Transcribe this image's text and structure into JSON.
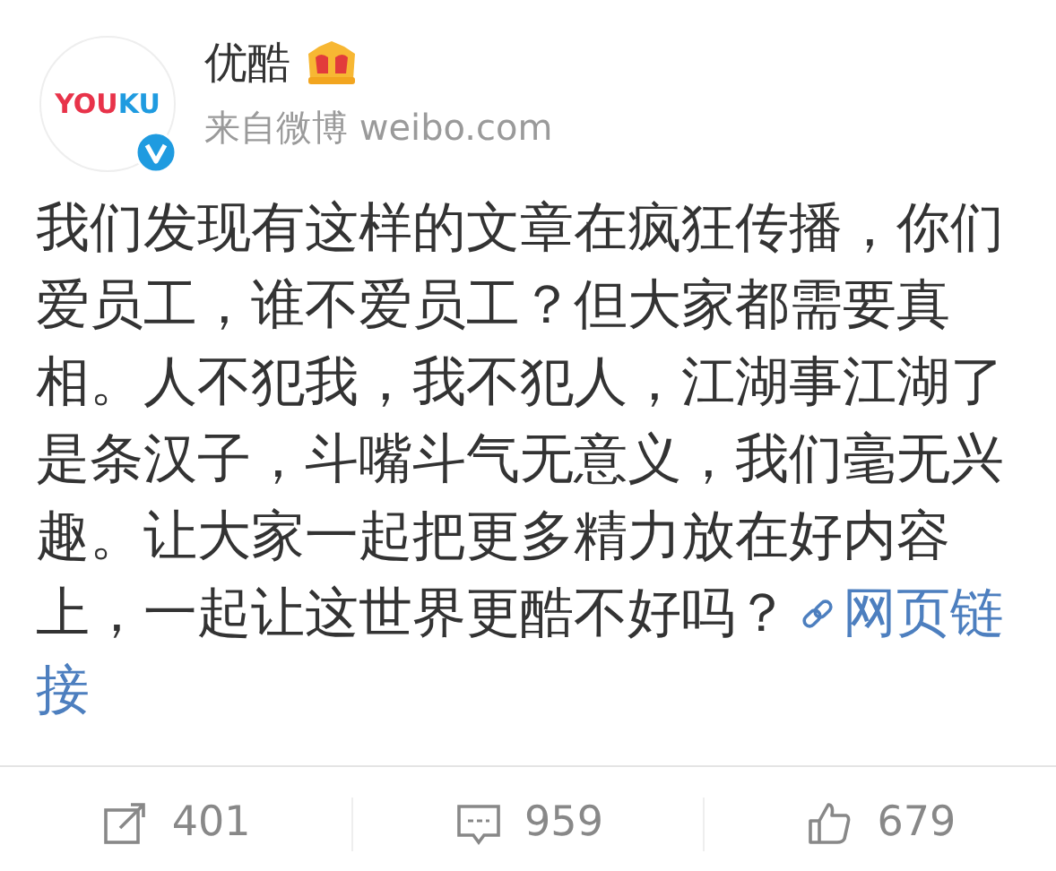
{
  "account": {
    "name": "优酷",
    "source": "来自微博 weibo.com",
    "logo_parts": [
      {
        "text": "YOU",
        "color": "#e8334a"
      },
      {
        "text": "KU",
        "color": "#1f9be0"
      }
    ],
    "verified": true,
    "vip": true
  },
  "post": {
    "text": "我们发现有这样的文章在疯狂传播，你们爱员工，谁不爱员工？但大家都需要真相。人不犯我，我不犯人，江湖事江湖了是条汉子，斗嘴斗气无意义，我们毫无兴趣。让大家一起把更多精力放在好内容上，一起让这世界更酷不好吗？",
    "link_lines": [
      "网页链",
      "接"
    ]
  },
  "actions": [
    {
      "kind": "repost",
      "count": "401"
    },
    {
      "kind": "comment",
      "count": "959"
    },
    {
      "kind": "like",
      "count": "679"
    }
  ]
}
